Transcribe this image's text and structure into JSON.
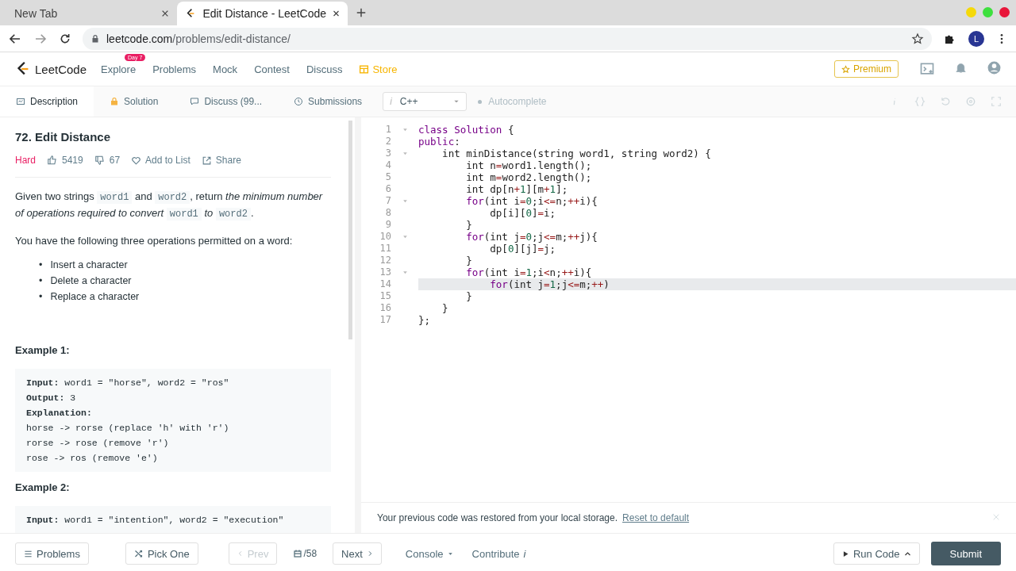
{
  "browser": {
    "tabs": [
      {
        "title": "New Tab",
        "selected": false
      },
      {
        "title": "Edit Distance - LeetCode",
        "selected": true
      }
    ],
    "url": {
      "host": "leetcode.com",
      "path": "/problems/edit-distance/"
    },
    "avatar": "L"
  },
  "nav": {
    "logo": "LeetCode",
    "items": [
      {
        "label": "Explore",
        "kind": "link",
        "badge": "Day 7"
      },
      {
        "label": "Problems",
        "kind": "link"
      },
      {
        "label": "Mock",
        "kind": "link"
      },
      {
        "label": "Contest",
        "kind": "link"
      },
      {
        "label": "Discuss",
        "kind": "link"
      },
      {
        "label": "Store",
        "kind": "store"
      }
    ],
    "premium": "Premium"
  },
  "panel_tabs": [
    {
      "label": "Description",
      "selected": true
    },
    {
      "label": "Solution",
      "selected": false
    },
    {
      "label": "Discuss (99...",
      "selected": false
    },
    {
      "label": "Submissions",
      "selected": false
    }
  ],
  "editor_toolbar": {
    "language_mark": "i",
    "language": "C++",
    "autocomplete": "Autocomplete",
    "autocomplete_on": false
  },
  "problem": {
    "title": "72. Edit Distance",
    "difficulty": "Hard",
    "likes": "5419",
    "dislikes": "67",
    "add_to_list": "Add to List",
    "share": "Share",
    "paragraph": [
      {
        "kind": "text",
        "text": "Given two strings "
      },
      {
        "kind": "code",
        "text": "word1"
      },
      {
        "kind": "text",
        "text": " and "
      },
      {
        "kind": "code",
        "text": "word2"
      },
      {
        "kind": "text",
        "text": ", return "
      },
      {
        "kind": "italic",
        "text": "the minimum number of operations required to convert "
      },
      {
        "kind": "code",
        "text": "word1"
      },
      {
        "kind": "italic",
        "text": " to "
      },
      {
        "kind": "code",
        "text": "word2"
      },
      {
        "kind": "text",
        "text": "."
      }
    ],
    "intro": "You have the following three operations permitted on a word:",
    "operations": [
      {
        "marker": "•",
        "text": "Insert a character"
      },
      {
        "marker": "•",
        "text": "Delete a character"
      },
      {
        "marker": "•",
        "text": "Replace a character"
      }
    ],
    "examples": [
      {
        "heading": "Example 1:",
        "lines": [
          "**Input:** word1 = \"horse\", word2 = \"ros\"",
          "**Output:** 3",
          "**Explanation:**",
          "horse -> rorse (replace 'h' with 'r')",
          "rorse -> rose (remove 'r')",
          "rose -> ros (remove 'e')"
        ]
      },
      {
        "heading": "Example 2:",
        "lines": [
          "**Input:** word1 = \"intention\", word2 = \"execution\""
        ]
      }
    ]
  },
  "code": [
    {
      "number": "1",
      "foldable": true,
      "active": false,
      "tokens": [
        {
          "kind": "kw",
          "text": "class "
        },
        {
          "kind": "def",
          "text": "Solution"
        },
        {
          "kind": "plain",
          "text": " {"
        }
      ]
    },
    {
      "number": "2",
      "foldable": false,
      "active": false,
      "tokens": [
        {
          "kind": "kw",
          "text": "public"
        },
        {
          "kind": "plain",
          "text": ":"
        }
      ]
    },
    {
      "number": "3",
      "foldable": true,
      "active": false,
      "tokens": [
        {
          "kind": "plain",
          "text": "    int minDistance(string word1, string word2) {"
        }
      ]
    },
    {
      "number": "4",
      "foldable": false,
      "active": false,
      "tokens": [
        {
          "kind": "plain",
          "text": "        int n"
        },
        {
          "kind": "op",
          "text": "="
        },
        {
          "kind": "plain",
          "text": "word1.length();"
        }
      ]
    },
    {
      "number": "5",
      "foldable": false,
      "active": false,
      "tokens": [
        {
          "kind": "plain",
          "text": "        int m"
        },
        {
          "kind": "op",
          "text": "="
        },
        {
          "kind": "plain",
          "text": "word2.length();"
        }
      ]
    },
    {
      "number": "6",
      "foldable": false,
      "active": false,
      "tokens": [
        {
          "kind": "plain",
          "text": "        int dp[n"
        },
        {
          "kind": "op",
          "text": "+"
        },
        {
          "kind": "num",
          "text": "1"
        },
        {
          "kind": "plain",
          "text": "][m"
        },
        {
          "kind": "op",
          "text": "+"
        },
        {
          "kind": "num",
          "text": "1"
        },
        {
          "kind": "plain",
          "text": "];"
        }
      ]
    },
    {
      "number": "7",
      "foldable": true,
      "active": false,
      "tokens": [
        {
          "kind": "kw",
          "text": "        for"
        },
        {
          "kind": "plain",
          "text": "(int i"
        },
        {
          "kind": "op",
          "text": "="
        },
        {
          "kind": "num",
          "text": "0"
        },
        {
          "kind": "plain",
          "text": ";i"
        },
        {
          "kind": "op",
          "text": "<="
        },
        {
          "kind": "plain",
          "text": "n;"
        },
        {
          "kind": "op",
          "text": "++"
        },
        {
          "kind": "plain",
          "text": "i){"
        }
      ]
    },
    {
      "number": "8",
      "foldable": false,
      "active": false,
      "tokens": [
        {
          "kind": "plain",
          "text": "            dp[i]["
        },
        {
          "kind": "num",
          "text": "0"
        },
        {
          "kind": "plain",
          "text": "]"
        },
        {
          "kind": "op",
          "text": "="
        },
        {
          "kind": "plain",
          "text": "i;"
        }
      ]
    },
    {
      "number": "9",
      "foldable": false,
      "active": false,
      "tokens": [
        {
          "kind": "plain",
          "text": "        }"
        }
      ]
    },
    {
      "number": "10",
      "foldable": true,
      "active": false,
      "tokens": [
        {
          "kind": "kw",
          "text": "        for"
        },
        {
          "kind": "plain",
          "text": "(int j"
        },
        {
          "kind": "op",
          "text": "="
        },
        {
          "kind": "num",
          "text": "0"
        },
        {
          "kind": "plain",
          "text": ";j"
        },
        {
          "kind": "op",
          "text": "<="
        },
        {
          "kind": "plain",
          "text": "m;"
        },
        {
          "kind": "op",
          "text": "++"
        },
        {
          "kind": "plain",
          "text": "j){"
        }
      ]
    },
    {
      "number": "11",
      "foldable": false,
      "active": false,
      "tokens": [
        {
          "kind": "plain",
          "text": "            dp["
        },
        {
          "kind": "num",
          "text": "0"
        },
        {
          "kind": "plain",
          "text": "][j]"
        },
        {
          "kind": "op",
          "text": "="
        },
        {
          "kind": "plain",
          "text": "j;"
        }
      ]
    },
    {
      "number": "12",
      "foldable": false,
      "active": false,
      "tokens": [
        {
          "kind": "plain",
          "text": "        }"
        }
      ]
    },
    {
      "number": "13",
      "foldable": true,
      "active": false,
      "tokens": [
        {
          "kind": "kw",
          "text": "        for"
        },
        {
          "kind": "plain",
          "text": "(int i"
        },
        {
          "kind": "op",
          "text": "="
        },
        {
          "kind": "num",
          "text": "1"
        },
        {
          "kind": "plain",
          "text": ";i"
        },
        {
          "kind": "op",
          "text": "<"
        },
        {
          "kind": "plain",
          "text": "n;"
        },
        {
          "kind": "op",
          "text": "++"
        },
        {
          "kind": "plain",
          "text": "i){"
        }
      ]
    },
    {
      "number": "14",
      "foldable": false,
      "active": true,
      "tokens": [
        {
          "kind": "kw",
          "text": "            for"
        },
        {
          "kind": "plain",
          "text": "(int j"
        },
        {
          "kind": "op",
          "text": "="
        },
        {
          "kind": "num",
          "text": "1"
        },
        {
          "kind": "plain",
          "text": ";j"
        },
        {
          "kind": "op",
          "text": "<="
        },
        {
          "kind": "plain",
          "text": "m;"
        },
        {
          "kind": "op",
          "text": "++"
        },
        {
          "kind": "plain",
          "text": ")"
        }
      ]
    },
    {
      "number": "15",
      "foldable": false,
      "active": false,
      "tokens": [
        {
          "kind": "plain",
          "text": "        }"
        }
      ]
    },
    {
      "number": "16",
      "foldable": false,
      "active": false,
      "tokens": [
        {
          "kind": "plain",
          "text": "    }"
        }
      ]
    },
    {
      "number": "17",
      "foldable": false,
      "active": false,
      "tokens": [
        {
          "kind": "plain",
          "text": "};"
        }
      ]
    }
  ],
  "notice": {
    "message": "Your previous code was restored from your local storage.",
    "link": "Reset to default"
  },
  "footer": {
    "problems": "Problems",
    "pick_one": "Pick One",
    "prev": "Prev",
    "prev_disabled": true,
    "counter": "/58",
    "next": "Next",
    "console": "Console",
    "contribute": "Contribute",
    "contribute_mark": "i",
    "run": "Run Code",
    "submit": "Submit"
  }
}
